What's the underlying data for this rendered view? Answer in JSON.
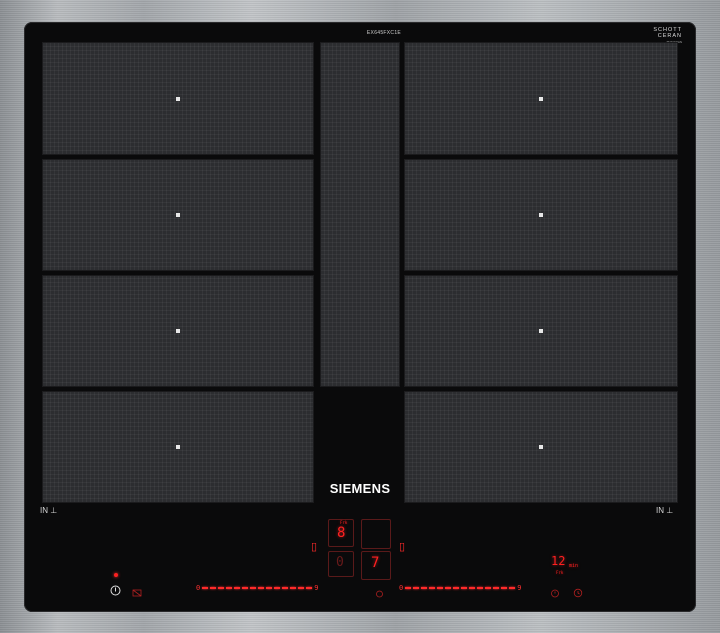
{
  "panel": {
    "model_code": "EX645FXC1E",
    "glass_brand_line1": "SCHOTT",
    "glass_brand_line2": "CERAN",
    "glass_brand_sub": "TM/CERAN",
    "brand": "SIEMENS",
    "induction_label_left": "IN",
    "induction_label_right": "IN"
  },
  "display": {
    "upper_left_digit": "8",
    "upper_left_small": "Frk",
    "lower_left_digit": "0",
    "lower_right_digit": "7",
    "timer_value": "12",
    "timer_unit": "min",
    "timer_small": "Frk"
  },
  "sliders": {
    "left_start": "0",
    "left_end": "9",
    "right_start": "0",
    "right_end": "9"
  },
  "colors": {
    "glass": "#0a0a0b",
    "zone": "#2c2d30",
    "indicator": "#ff2a2a",
    "frame": "#a3a7ab"
  },
  "icons": {
    "power": "power-icon",
    "child_lock": "lock-icon",
    "pan": "pan-icon",
    "timer": "timer-icon",
    "clock": "clock-icon"
  }
}
